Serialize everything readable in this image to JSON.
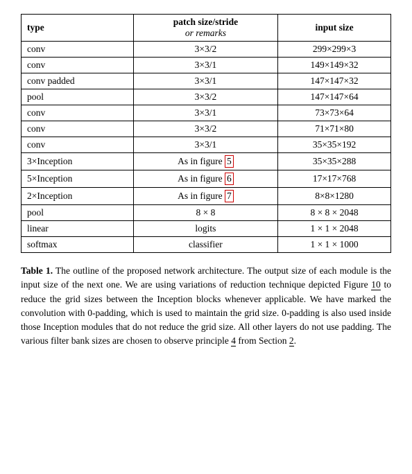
{
  "table": {
    "headers": {
      "type": "type",
      "patch": "patch size/stride",
      "patch_sub": "or remarks",
      "input": "input size"
    },
    "rows": [
      {
        "type": "conv",
        "patch": "3×3/2",
        "input": "299×299×3"
      },
      {
        "type": "conv",
        "patch": "3×3/1",
        "input": "149×149×32"
      },
      {
        "type": "conv padded",
        "patch": "3×3/1",
        "input": "147×147×32"
      },
      {
        "type": "pool",
        "patch": "3×3/2",
        "input": "147×147×64"
      },
      {
        "type": "conv",
        "patch": "3×3/1",
        "input": "73×73×64"
      },
      {
        "type": "conv",
        "patch": "3×3/2",
        "input": "71×71×80"
      },
      {
        "type": "conv",
        "patch": "3×3/1",
        "input": "35×35×192"
      },
      {
        "type": "3×Inception",
        "patch": "As in figure 5",
        "input": "35×35×288",
        "highlight": "5"
      },
      {
        "type": "5×Inception",
        "patch": "As in figure 6",
        "input": "17×17×768",
        "highlight": "6"
      },
      {
        "type": "2×Inception",
        "patch": "As in figure 7",
        "input": "8×8×1280",
        "highlight": "7"
      },
      {
        "type": "pool",
        "patch": "8 × 8",
        "input": "8 × 8 × 2048"
      },
      {
        "type": "linear",
        "patch": "logits",
        "input": "1 × 1 × 2048"
      },
      {
        "type": "softmax",
        "patch": "classifier",
        "input": "1 × 1 × 1000"
      }
    ]
  },
  "caption": {
    "label": "Table 1.",
    "text": " The outline of the proposed network architecture.  The output size of each module is the input size of the next one.  We are using variations of reduction technique depicted Figure ",
    "ref10": "10",
    "text2": " to reduce the grid sizes between the Inception blocks whenever applicable.  We have marked the convolution with 0-padding, which is used to maintain the grid size.  0-padding is also used inside those Inception modules that do not reduce the grid size.  All other layers do not use padding.  The various filter bank sizes are chosen to observe principle ",
    "ref4": "4",
    "text3": " from Section ",
    "ref2": "2",
    "text4": "."
  }
}
